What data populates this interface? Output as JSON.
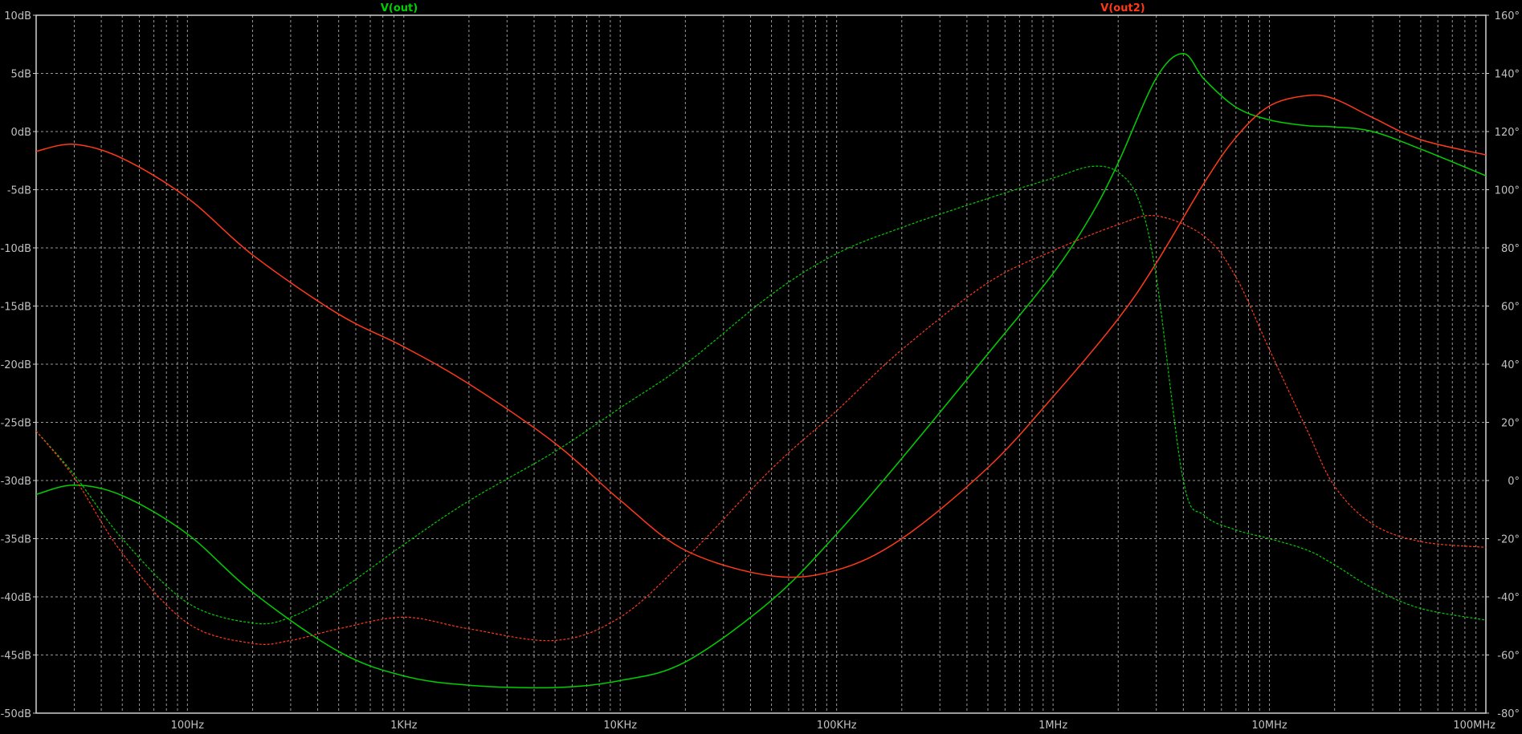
{
  "colors": {
    "background": "#000000",
    "grid": "#9a9a9a",
    "axis_text": "#c0c0c0",
    "out": "#00d000",
    "out2": "#ff3a1a"
  },
  "chart_data": {
    "type": "line",
    "x_scale": "log",
    "xlim": [
      20,
      100000000
    ],
    "ylim": [
      -50,
      10
    ],
    "y2lim": [
      -80,
      160
    ],
    "grid": true,
    "x_ticks": [
      {
        "v": 100,
        "label": "100Hz"
      },
      {
        "v": 1000,
        "label": "1KHz"
      },
      {
        "v": 10000,
        "label": "10KHz"
      },
      {
        "v": 100000,
        "label": "100KHz"
      },
      {
        "v": 1000000,
        "label": "1MHz"
      },
      {
        "v": 10000000,
        "label": "10MHz"
      },
      {
        "v": 100000000,
        "label": "100MHz"
      }
    ],
    "y_ticks": [
      {
        "v": 10,
        "label": "10dB"
      },
      {
        "v": 5,
        "label": "5dB"
      },
      {
        "v": 0,
        "label": "0dB"
      },
      {
        "v": -5,
        "label": "-5dB"
      },
      {
        "v": -10,
        "label": "-10dB"
      },
      {
        "v": -15,
        "label": "-15dB"
      },
      {
        "v": -20,
        "label": "-20dB"
      },
      {
        "v": -25,
        "label": "-25dB"
      },
      {
        "v": -30,
        "label": "-30dB"
      },
      {
        "v": -35,
        "label": "-35dB"
      },
      {
        "v": -40,
        "label": "-40dB"
      },
      {
        "v": -45,
        "label": "-45dB"
      },
      {
        "v": -50,
        "label": "-50dB"
      }
    ],
    "y2_ticks": [
      {
        "v": 160,
        "label": "160°"
      },
      {
        "v": 140,
        "label": "140°"
      },
      {
        "v": 120,
        "label": "120°"
      },
      {
        "v": 100,
        "label": "100°"
      },
      {
        "v": 80,
        "label": "80°"
      },
      {
        "v": 60,
        "label": "60°"
      },
      {
        "v": 40,
        "label": "40°"
      },
      {
        "v": 20,
        "label": "20°"
      },
      {
        "v": 0,
        "label": "0°"
      },
      {
        "v": -20,
        "label": "-20°"
      },
      {
        "v": -40,
        "label": "-40°"
      },
      {
        "v": -60,
        "label": "-60°"
      },
      {
        "v": -80,
        "label": "-80°"
      }
    ],
    "series": [
      {
        "name": "V(out)",
        "key": "out",
        "trace": "magnitude",
        "axis": "left",
        "x": [
          20,
          30,
          50,
          100,
          200,
          500,
          1000,
          2000,
          5000,
          10000,
          20000,
          50000,
          100000,
          200000,
          500000,
          1000000,
          1500000,
          2000000,
          3000000,
          4000000,
          5000000,
          7000000,
          10000000,
          15000000,
          20000000,
          30000000,
          50000000,
          100000000
        ],
        "y": [
          -31.2,
          -30.4,
          -31.3,
          -34.6,
          -39.6,
          -44.7,
          -46.8,
          -47.6,
          -47.8,
          -47.2,
          -45.6,
          -40.3,
          -34.6,
          -28.1,
          -19.1,
          -12.2,
          -7.2,
          -2.7,
          4.6,
          6.7,
          4.5,
          2.1,
          1.0,
          0.5,
          0.4,
          0.0,
          -1.5,
          -3.8
        ]
      },
      {
        "name": "V(out2)",
        "key": "out2",
        "trace": "magnitude",
        "axis": "left",
        "x": [
          20,
          30,
          50,
          100,
          200,
          500,
          1000,
          2000,
          5000,
          10000,
          20000,
          50000,
          100000,
          200000,
          500000,
          1000000,
          2000000,
          3000000,
          5000000,
          7000000,
          10000000,
          15000000,
          20000000,
          30000000,
          50000000,
          100000000
        ],
        "y": [
          -1.7,
          -1.1,
          -2.3,
          -5.7,
          -10.6,
          -15.7,
          -18.5,
          -21.7,
          -26.8,
          -31.7,
          -36.0,
          -38.2,
          -37.7,
          -35.0,
          -28.9,
          -22.8,
          -16.1,
          -11.3,
          -4.4,
          -0.5,
          2.2,
          3.1,
          2.8,
          1.2,
          -0.7,
          -2.0
        ]
      },
      {
        "name": "V(out)",
        "key": "out",
        "trace": "phase",
        "axis": "right",
        "x": [
          20,
          30,
          50,
          100,
          200,
          300,
          500,
          1000,
          2000,
          5000,
          10000,
          20000,
          50000,
          100000,
          200000,
          500000,
          1000000,
          1500000,
          2000000,
          2500000,
          3000000,
          4000000,
          5000000,
          7000000,
          10000000,
          15000000,
          20000000,
          30000000,
          50000000,
          100000000
        ],
        "y": [
          17,
          2,
          -20,
          -42,
          -49,
          -47,
          -38,
          -22,
          -7,
          10,
          25,
          40,
          64,
          78,
          87,
          97,
          104,
          108,
          106,
          96,
          70,
          0,
          -12,
          -17,
          -20,
          -24,
          -29,
          -37,
          -44,
          -48
        ]
      },
      {
        "name": "V(out2)",
        "key": "out2",
        "trace": "phase",
        "axis": "right",
        "x": [
          20,
          30,
          50,
          100,
          200,
          300,
          500,
          1000,
          2000,
          5000,
          10000,
          20000,
          50000,
          100000,
          200000,
          500000,
          1000000,
          2000000,
          3000000,
          5000000,
          7000000,
          10000000,
          15000000,
          20000000,
          30000000,
          50000000,
          100000000
        ],
        "y": [
          17,
          1,
          -25,
          -49,
          -56,
          -55,
          -51,
          -47,
          -51,
          -55,
          -47,
          -27,
          4,
          24,
          45,
          68,
          79,
          88,
          91,
          84,
          70,
          45,
          17,
          -2,
          -15,
          -21,
          -23
        ]
      }
    ]
  }
}
